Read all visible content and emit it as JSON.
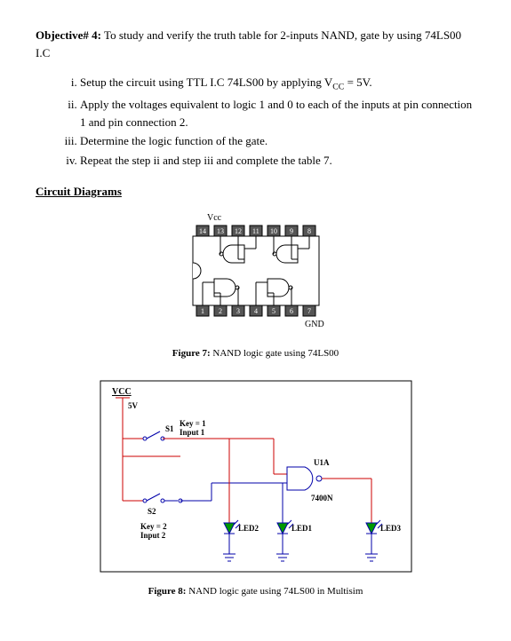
{
  "objective": {
    "label": "Objective# 4:",
    "text": "To study and verify the truth table for 2-inputs NAND, gate by using 74LS00 I.C"
  },
  "steps": [
    "Setup the circuit using TTL I.C 74LS00 by applying V",
    "Apply the voltages equivalent to logic 1 and 0 to each of the inputs at pin connection 1 and pin connection 2.",
    "Determine the logic function of the gate.",
    "Repeat the step ii and step iii and complete the table 7."
  ],
  "step1_sub": "CC",
  "step1_tail": " = 5V.",
  "section_title": "Circuit Diagrams",
  "fig7": {
    "vcc": "Vcc",
    "gnd": "GND",
    "pins_top": [
      "14",
      "13",
      "12",
      "11",
      "10",
      "9",
      "8"
    ],
    "pins_bottom": [
      "1",
      "2",
      "3",
      "4",
      "5",
      "6",
      "7"
    ],
    "caption_label": "Figure 7:",
    "caption_text": " NAND logic gate using 74LS00"
  },
  "fig8": {
    "vcc": "VCC",
    "v5": "5V",
    "s1": "S1",
    "key1_a": "Key = 1",
    "key1_b": "Input 1",
    "s2": "S2",
    "key2_a": "Key = 2",
    "key2_b": "Input 2",
    "u1a": "U1A",
    "chip": "7400N",
    "led1": "LED1",
    "led2": "LED2",
    "led3": "LED3",
    "caption_label": "Figure 8:",
    "caption_text": " NAND logic gate using 74LS00 in Multisim"
  }
}
